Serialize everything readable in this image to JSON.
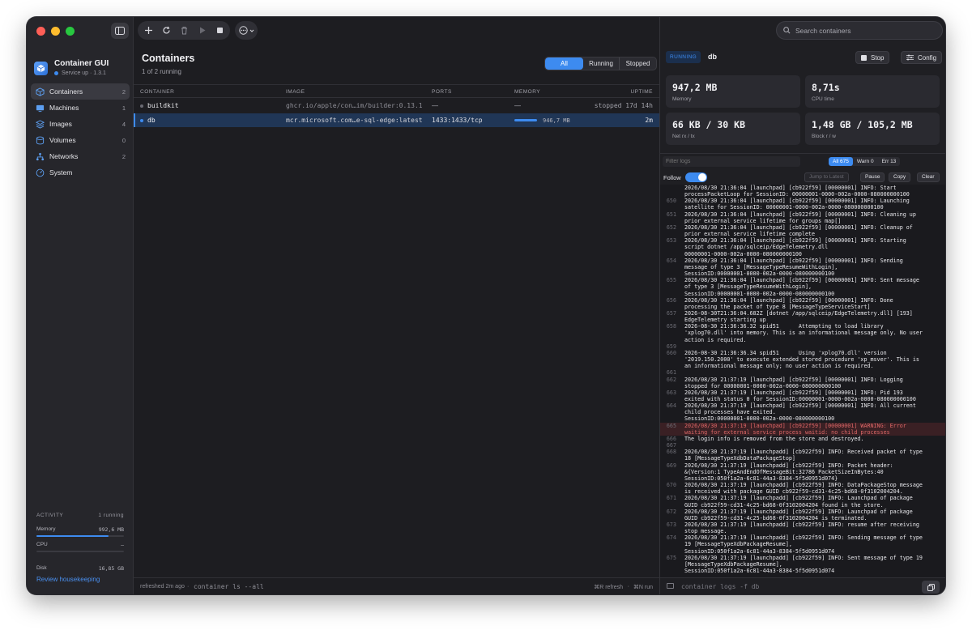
{
  "app": {
    "name": "Container GUI",
    "status": "Service up · 1.3.1"
  },
  "sidebar": {
    "items": [
      {
        "label": "Containers",
        "count": "2",
        "icon": "cube-icon"
      },
      {
        "label": "Machines",
        "count": "1",
        "icon": "monitor-icon"
      },
      {
        "label": "Images",
        "count": "4",
        "icon": "layers-icon"
      },
      {
        "label": "Volumes",
        "count": "0",
        "icon": "cylinder-icon"
      },
      {
        "label": "Networks",
        "count": "2",
        "icon": "network-icon"
      },
      {
        "label": "System",
        "count": "",
        "icon": "gauge-icon"
      }
    ],
    "activity": {
      "title": "ACTIVITY",
      "running": "1 running",
      "memory_label": "Memory",
      "memory_value": "992,6 MB",
      "memory_fraction": 0.82,
      "cpu_label": "CPU",
      "cpu_value": "—",
      "disk_label": "Disk",
      "disk_value": "16,85 GB"
    },
    "review_link": "Review housekeeping"
  },
  "main": {
    "title": "Containers",
    "subtitle": "1 of 2 running",
    "filters": [
      "All",
      "Running",
      "Stopped"
    ],
    "active_filter": "All",
    "columns": [
      "CONTAINER",
      "IMAGE",
      "PORTS",
      "MEMORY",
      "UPTIME"
    ],
    "rows": [
      {
        "name": "buildkit",
        "image": "ghcr.io/apple/con…im/builder:0.13.1",
        "ports": "—",
        "memory": "—",
        "uptime": "stopped 17d 14h",
        "running": false
      },
      {
        "name": "db",
        "image": "mcr.microsoft.com…e-sql-edge:latest",
        "ports": "1433:1433/tcp",
        "memory": "946,7 MB",
        "uptime": "2m",
        "running": true
      }
    ],
    "footer": {
      "refreshed": "refreshed 2m ago",
      "sep": "·",
      "command": "container ls --all",
      "refresh_hint": "⌘R refresh",
      "sep2": "·",
      "run_hint": "⌘N run"
    }
  },
  "search": {
    "placeholder": "Search containers"
  },
  "detail": {
    "state": "RUNNING",
    "name": "db",
    "stop_label": "Stop",
    "config_label": "Config",
    "stats": [
      {
        "value": "947,2 MB",
        "label": "Memory"
      },
      {
        "value": "8,71s",
        "label": "CPU time"
      },
      {
        "value": "66 KB / 30 KB",
        "label": "Net rx / tx"
      },
      {
        "value": "1,48 GB / 105,2 MB",
        "label": "Block r / w"
      }
    ],
    "filter_placeholder": "Filter logs",
    "levels": [
      "All 675",
      "Warn 0",
      "Err 13"
    ],
    "follow_label": "Follow",
    "jump_label": "Jump to Latest",
    "pause_label": "Pause",
    "copy_label": "Copy",
    "clear_label": "Clear",
    "command": "container logs -f db",
    "logs": [
      {
        "n": "",
        "t": "2026/08/30 21:36:04 [launchpad] [cb922f59] [00000001] INFO: Start\nprocessPacketLoop for SessionID: 00000001-0000-002a-0000-080000000100"
      },
      {
        "n": "650",
        "t": "2026/08/30 21:36:04 [launchpad] [cb922f59] [00000001] INFO: Launching\nsatellite for SessionID: 00000001-0000-002a-0000-080000000100"
      },
      {
        "n": "651",
        "t": "2026/08/30 21:36:04 [launchpad] [cb922f59] [00000001] INFO: Cleaning up\nprior external service lifetime for groups map[]"
      },
      {
        "n": "652",
        "t": "2026/08/30 21:36:04 [launchpad] [cb922f59] [00000001] INFO: Cleanup of\nprior external service lifetime complete"
      },
      {
        "n": "653",
        "t": "2026/08/30 21:36:04 [launchpad] [cb922f59] [00000001] INFO: Starting\nscript dotnet /app/sqlceip/EdgeTelemetry.dll\n00000001-0000-002a-0000-080000000100"
      },
      {
        "n": "654",
        "t": "2026/08/30 21:36:04 [launchpad] [cb922f59] [00000001] INFO: Sending\nmessage of type 3 [MessageTypeResumeWithLogin],\nSessionID:00000001-0000-002a-0000-080000000100"
      },
      {
        "n": "655",
        "t": "2026/08/30 21:36:04 [launchpad] [cb922f59] [00000001] INFO: Sent message\nof type 3 [MessageTypeResumeWithLogin],\nSessionID:00000001-0000-002a-0000-080000000100"
      },
      {
        "n": "656",
        "t": "2026/08/30 21:36:04 [launchpad] [cb922f59] [00000001] INFO: Done\nprocessing the packet of type 8 [MessageTypeServiceStart]"
      },
      {
        "n": "657",
        "t": "2026-08-30T21:36:04.682Z [dotnet /app/sqlceip/EdgeTelemetry.dll] [193]\nEdgeTelemetry starting up"
      },
      {
        "n": "658",
        "t": "2026-08-30 21:36:36.32 spid51      Attempting to load library\n'xplog70.dll' into memory. This is an informational message only. No user\naction is required."
      },
      {
        "n": "659",
        "t": ""
      },
      {
        "n": "660",
        "t": "2026-08-30 21:36:36.34 spid51      Using 'xplog70.dll' version\n'2019.150.2000' to execute extended stored procedure 'xp_msver'. This is\nan informational message only; no user action is required."
      },
      {
        "n": "661",
        "t": ""
      },
      {
        "n": "662",
        "t": "2026/08/30 21:37:19 [launchpad] [cb922f59] [00000001] INFO: Logging\nstopped for 00000001-0000-002a-0000-080000000100"
      },
      {
        "n": "663",
        "t": "2026/08/30 21:37:19 [launchpad] [cb922f59] [00000001] INFO: Pid 193\nexited with status 0 for SessionID:00000001-0000-002a-0000-080000000100"
      },
      {
        "n": "664",
        "t": "2026/08/30 21:37:19 [launchpad] [cb922f59] [00000001] INFO: All current\nchild processes have exited.\nSessionID:00000001-0000-002a-0000-080000000100"
      },
      {
        "n": "665",
        "t": "2026/08/30 21:37:19 [launchpad] [cb922f59] [00000001] WARNING: Error\nwaiting for external service process waitid: no child processes",
        "warn": true
      },
      {
        "n": "666",
        "t": "The login info is removed from the store and destroyed."
      },
      {
        "n": "667",
        "t": ""
      },
      {
        "n": "668",
        "t": "2026/08/30 21:37:19 [launchpadd] [cb922f59] INFO: Received packet of type\n18 [MessageTypeXdbDataPackageStop]"
      },
      {
        "n": "669",
        "t": "2026/08/30 21:37:19 [launchpadd] [cb922f59] INFO: Packet header:\n&{Version:1 TypeAndEndOfMessageBit:32786 PacketSizeInBytes:40\nSessionID:050f1a2a-6c81-44a3-8384-5f5d0951d074}"
      },
      {
        "n": "670",
        "t": "2026/08/30 21:37:19 [launchpadd] [cb922f59] INFO: DataPackageStop message\nis received with package GUID cb922f59-cd31-4c25-bd68-0f3102004204."
      },
      {
        "n": "671",
        "t": "2026/08/30 21:37:19 [launchpadd] [cb922f59] INFO: Launchpad of package\nGUID cb922f59-cd31-4c25-bd68-0f3102004204 found in the store."
      },
      {
        "n": "672",
        "t": "2026/08/30 21:37:19 [launchpadd] [cb922f59] INFO: Launchpad of package\nGUID cb922f59-cd31-4c25-bd68-0f3102004204 is terminated."
      },
      {
        "n": "673",
        "t": "2026/08/30 21:37:19 [launchpadd] [cb922f59] INFO: resume after receiving\nstop message."
      },
      {
        "n": "674",
        "t": "2026/08/30 21:37:19 [launchpadd] [cb922f59] INFO: Sending message of type\n19 [MessageTypeXdbPackageResume],\nSessionID:050f1a2a-6c81-44a3-8384-5f5d0951d074"
      },
      {
        "n": "675",
        "t": "2026/08/30 21:37:19 [launchpadd] [cb922f59] INFO: Sent message of type 19\n[MessageTypeXdbPackageResume],\nSessionID:050f1a2a-6c81-44a3-8384-5f5d0951d074"
      }
    ]
  },
  "colors": {
    "accent": "#3d8bf0",
    "warn_text": "#e06868",
    "traffic_red": "#ff5f57",
    "traffic_yellow": "#febc2e",
    "traffic_green": "#28c840"
  }
}
